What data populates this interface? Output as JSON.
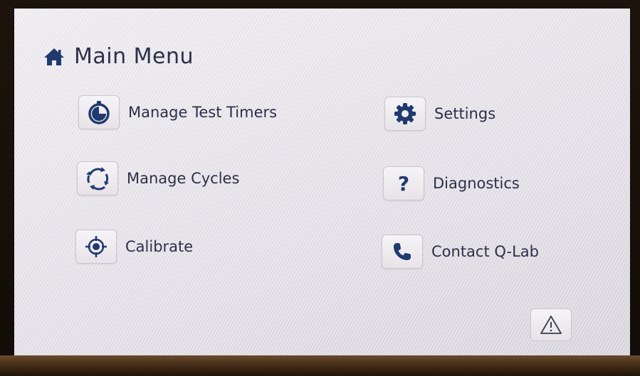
{
  "header": {
    "title": "Main Menu",
    "icon": "home-icon"
  },
  "menu": {
    "items": [
      {
        "label": "Manage Test Timers",
        "icon": "stopwatch-icon"
      },
      {
        "label": "Settings",
        "icon": "gear-icon"
      },
      {
        "label": "Manage Cycles",
        "icon": "cycle-icon"
      },
      {
        "label": "Diagnostics",
        "icon": "question-icon"
      },
      {
        "label": "Calibrate",
        "icon": "crosshair-icon"
      },
      {
        "label": "Contact Q-Lab",
        "icon": "phone-icon"
      }
    ]
  },
  "alert": {
    "icon": "warning-icon"
  },
  "colors": {
    "icon_blue": "#1f3a6e",
    "text": "#2c3048",
    "screen_bg": "#ece9ef"
  }
}
